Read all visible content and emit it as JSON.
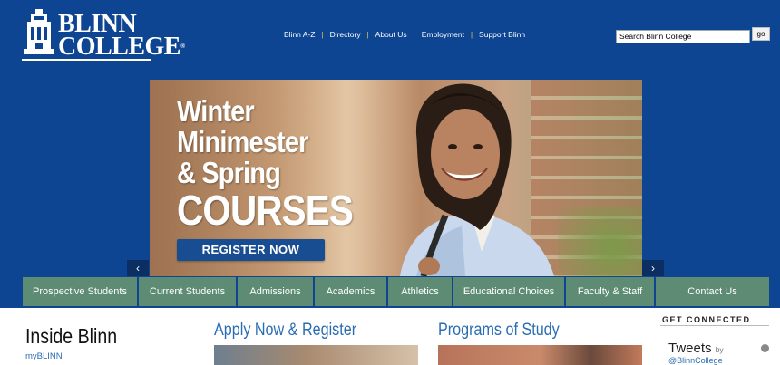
{
  "header": {
    "logo_line1": "BLINN",
    "logo_line2": "COLLEGE",
    "logo_reg": "®",
    "nav": [
      "Blinn A-Z",
      "Directory",
      "About Us",
      "Employment",
      "Support Blinn"
    ],
    "search": {
      "value": "Search Blinn College",
      "button_label": "go"
    }
  },
  "banner": {
    "line1": "Winter",
    "line2": "Minimester",
    "line3": "& Spring",
    "line4": "COURSES",
    "cta": "REGISTER NOW",
    "prev_icon": "chevron-left-icon",
    "next_icon": "chevron-right-icon"
  },
  "mainnav": [
    "Prospective Students",
    "Current Students",
    "Admissions",
    "Academics",
    "Athletics",
    "Educational Choices",
    "Faculty & Staff",
    "Contact Us"
  ],
  "lower": {
    "inside_title": "Inside Blinn",
    "inside_link": "myBLINN",
    "apply_title": "Apply Now & Register",
    "programs_title": "Programs of Study",
    "connect_title": "GET CONNECTED",
    "tweets_label": "Tweets",
    "tweets_by": "by",
    "tweets_handle": "@BlinnCollege",
    "info_icon": "info-icon"
  },
  "colors": {
    "brand_blue": "#0d4593",
    "nav_green": "#5d8b74",
    "link_blue": "#2a6db3",
    "accent_gold": "#f3c945"
  }
}
